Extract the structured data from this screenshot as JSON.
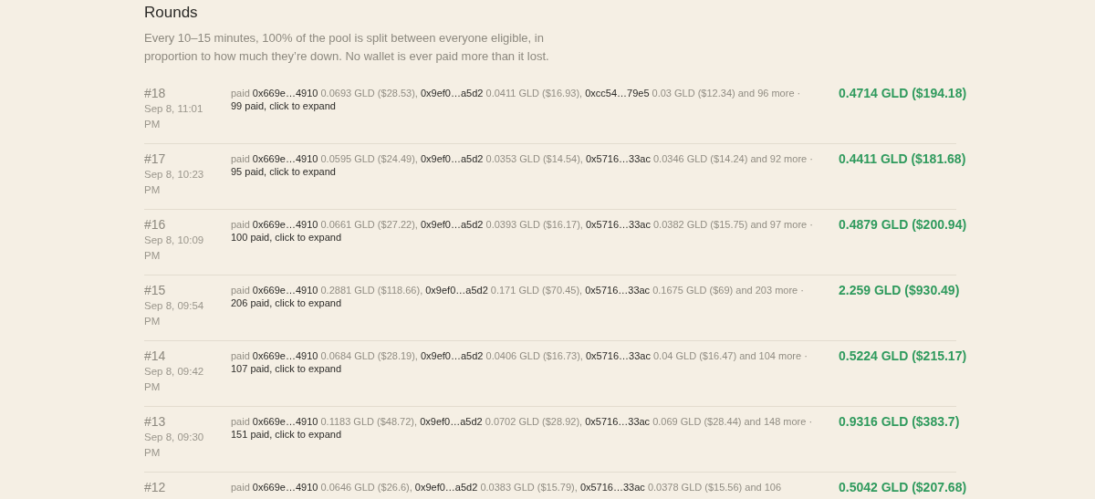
{
  "section": {
    "title": "Rounds",
    "description": "Every 10–15 minutes, 100% of the pool is split between everyone eligible, in proportion to how much they’re down. No wallet is ever paid more than it lost."
  },
  "rounds": [
    {
      "number": "#18",
      "date": "Sep 8, 11:01 PM",
      "lead": "paid",
      "payouts": [
        {
          "address": "0x669e…4910",
          "amount": "0.0693 GLD ($28.53),"
        },
        {
          "address": "0x9ef0…a5d2",
          "amount": "0.0411 GLD ($16.93),"
        },
        {
          "address": "0xcc54…79e5",
          "amount": "0.03 GLD ($12.34)"
        }
      ],
      "rest": "and 96 more",
      "separator": "·",
      "expand": "99 paid, click to expand",
      "total": "0.4714 GLD ($194.18)"
    },
    {
      "number": "#17",
      "date": "Sep 8, 10:23 PM",
      "lead": "paid",
      "payouts": [
        {
          "address": "0x669e…4910",
          "amount": "0.0595 GLD ($24.49),"
        },
        {
          "address": "0x9ef0…a5d2",
          "amount": "0.0353 GLD ($14.54),"
        },
        {
          "address": "0x5716…33ac",
          "amount": "0.0346 GLD ($14.24)"
        }
      ],
      "rest": "and 92 more",
      "separator": "·",
      "expand": "95 paid, click to expand",
      "total": "0.4411 GLD ($181.68)"
    },
    {
      "number": "#16",
      "date": "Sep 8, 10:09 PM",
      "lead": "paid",
      "payouts": [
        {
          "address": "0x669e…4910",
          "amount": "0.0661 GLD ($27.22),"
        },
        {
          "address": "0x9ef0…a5d2",
          "amount": "0.0393 GLD ($16.17),"
        },
        {
          "address": "0x5716…33ac",
          "amount": "0.0382 GLD ($15.75)"
        }
      ],
      "rest": "and 97 more",
      "separator": "·",
      "expand": "100 paid, click to expand",
      "total": "0.4879 GLD ($200.94)"
    },
    {
      "number": "#15",
      "date": "Sep 8, 09:54 PM",
      "lead": "paid",
      "payouts": [
        {
          "address": "0x669e…4910",
          "amount": "0.2881 GLD ($118.66),"
        },
        {
          "address": "0x9ef0…a5d2",
          "amount": "0.171 GLD ($70.45),"
        },
        {
          "address": "0x5716…33ac",
          "amount": "0.1675 GLD ($69)"
        }
      ],
      "rest": "and 203 more",
      "separator": "·",
      "expand": "206 paid, click to expand",
      "total": "2.259 GLD ($930.49)"
    },
    {
      "number": "#14",
      "date": "Sep 8, 09:42 PM",
      "lead": "paid",
      "payouts": [
        {
          "address": "0x669e…4910",
          "amount": "0.0684 GLD ($28.19),"
        },
        {
          "address": "0x9ef0…a5d2",
          "amount": "0.0406 GLD ($16.73),"
        },
        {
          "address": "0x5716…33ac",
          "amount": "0.04 GLD ($16.47)"
        }
      ],
      "rest": "and 104 more",
      "separator": "·",
      "expand": "107 paid, click to expand",
      "total": "0.5224 GLD ($215.17)"
    },
    {
      "number": "#13",
      "date": "Sep 8, 09:30 PM",
      "lead": "paid",
      "payouts": [
        {
          "address": "0x669e…4910",
          "amount": "0.1183 GLD ($48.72),"
        },
        {
          "address": "0x9ef0…a5d2",
          "amount": "0.0702 GLD ($28.92),"
        },
        {
          "address": "0x5716…33ac",
          "amount": "0.069 GLD ($28.44)"
        }
      ],
      "rest": "and 148 more",
      "separator": "·",
      "expand": "151 paid, click to expand",
      "total": "0.9316 GLD ($383.7)"
    },
    {
      "number": "#12",
      "lead": "paid",
      "payouts": [
        {
          "address": "0x669e…4910",
          "amount": "0.0646 GLD ($26.6),"
        },
        {
          "address": "0x9ef0…a5d2",
          "amount": "0.0383 GLD ($15.79),"
        },
        {
          "address": "0x5716…33ac",
          "amount": "0.0378 GLD ($15.56)"
        }
      ],
      "rest": "and 106",
      "total": "0.5042 GLD ($207.68)"
    }
  ]
}
